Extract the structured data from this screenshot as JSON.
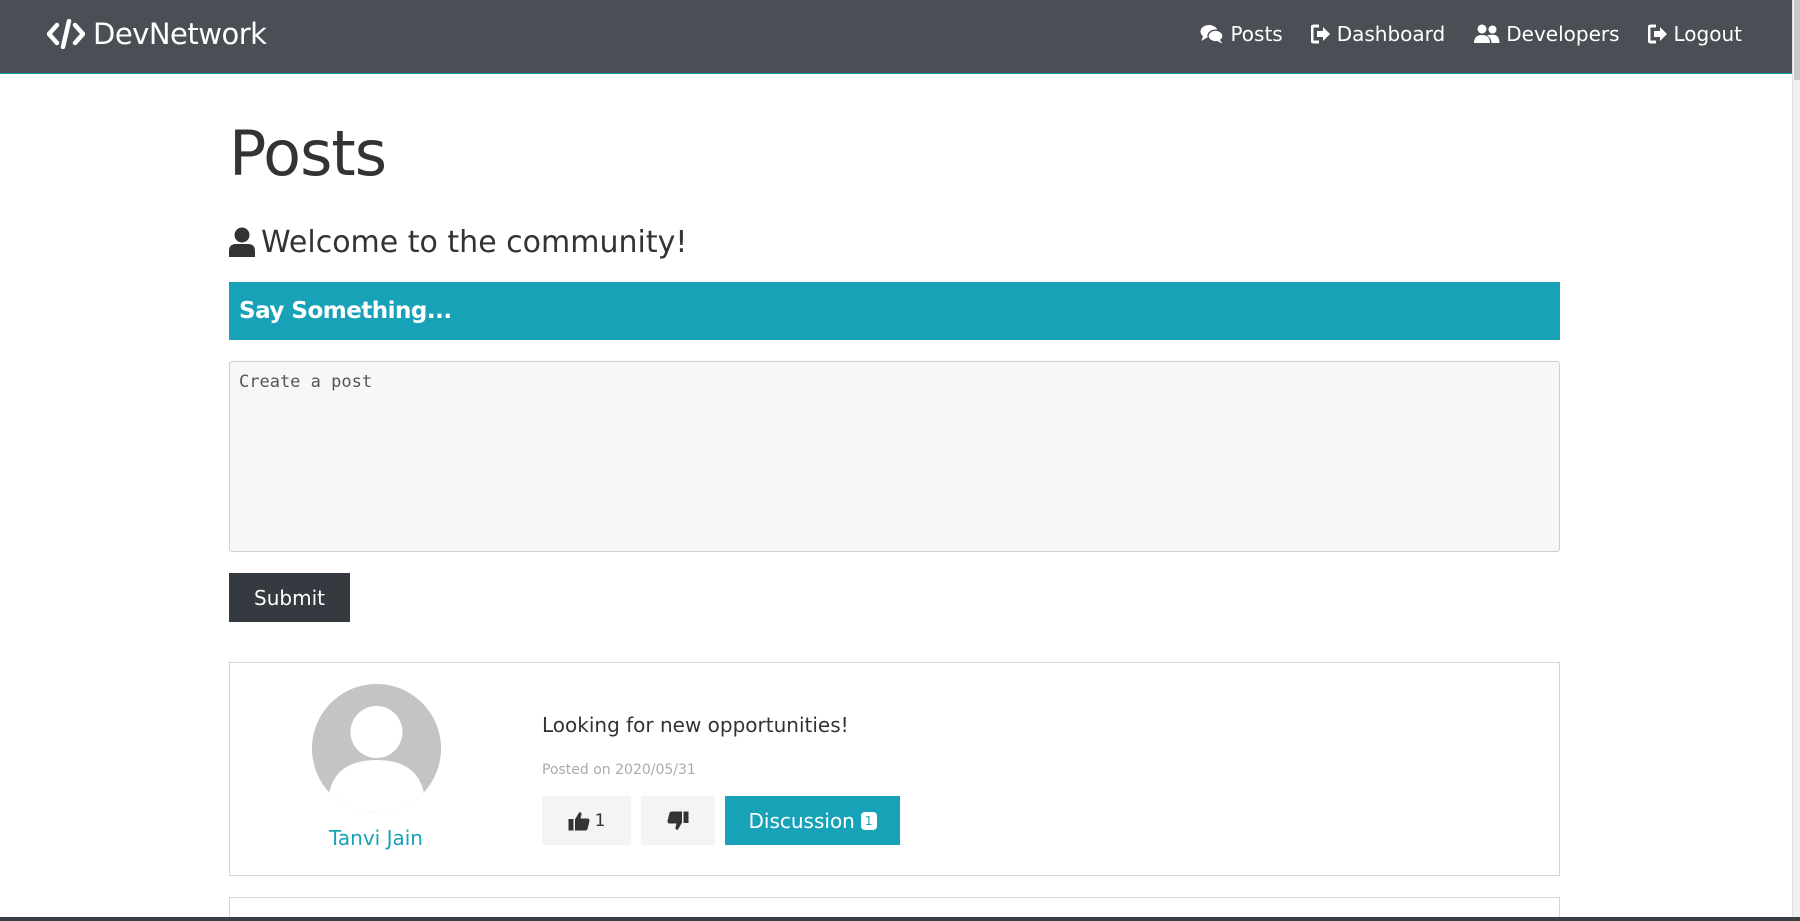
{
  "navbar": {
    "brand": "DevNetwork",
    "links": [
      {
        "label": "Posts",
        "icon": "comments-icon"
      },
      {
        "label": "Dashboard",
        "icon": "sign-out-icon"
      },
      {
        "label": "Developers",
        "icon": "users-icon"
      },
      {
        "label": "Logout",
        "icon": "sign-out-icon"
      }
    ],
    "colors": {
      "background": "#4a4e55",
      "text": "#ffffff"
    }
  },
  "main": {
    "title": "Posts",
    "welcome": "Welcome to the community!",
    "banner": "Say Something...",
    "textarea_placeholder": "Create a post",
    "textarea_value": "",
    "submit_label": "Submit"
  },
  "posts": [
    {
      "author": "Tanvi Jain",
      "text": "Looking for new opportunities!",
      "date": "Posted on 2020/05/31",
      "likes": "1",
      "discussion_label": "Discussion",
      "comment_count": "1"
    }
  ],
  "colors": {
    "accent": "#17a2b8",
    "dark": "#343a40",
    "text": "#333333",
    "muted": "#aaaaaa"
  }
}
